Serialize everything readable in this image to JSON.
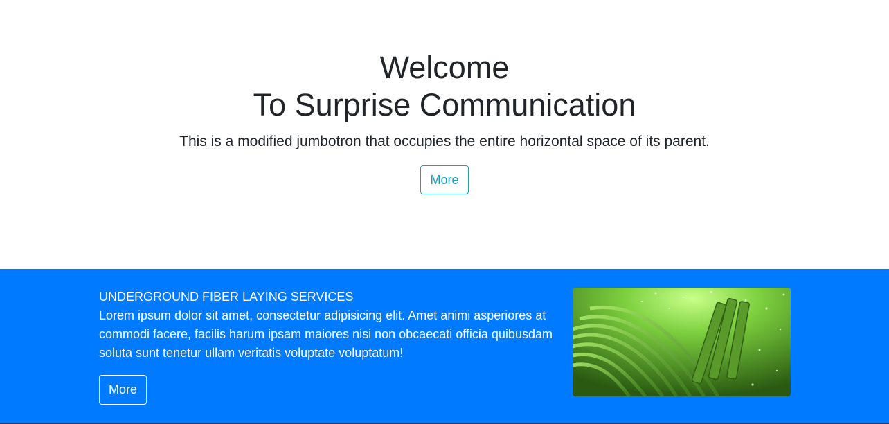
{
  "jumbotron": {
    "title_line1": "Welcome",
    "title_line2": "To Surprise Communication",
    "lead": "This is a modified jumbotron that occupies the entire horizontal space of its parent.",
    "more_label": "More",
    "accent_color": "#17a2b8"
  },
  "service": {
    "title": "UNDERGROUND FIBER LAYING SERVICES",
    "text": "Lorem ipsum dolor sit amet, consectetur adipisicing elit. Amet animi asperiores at commodi facere, facilis harum ipsam maiores nisi non obcaecati officia quibusdam soluta sunt tenetur ullam veritatis voluptate voluptatum!",
    "more_label": "More",
    "background_color": "#007bff",
    "image_icon": "fiber-optic-cables-image"
  }
}
